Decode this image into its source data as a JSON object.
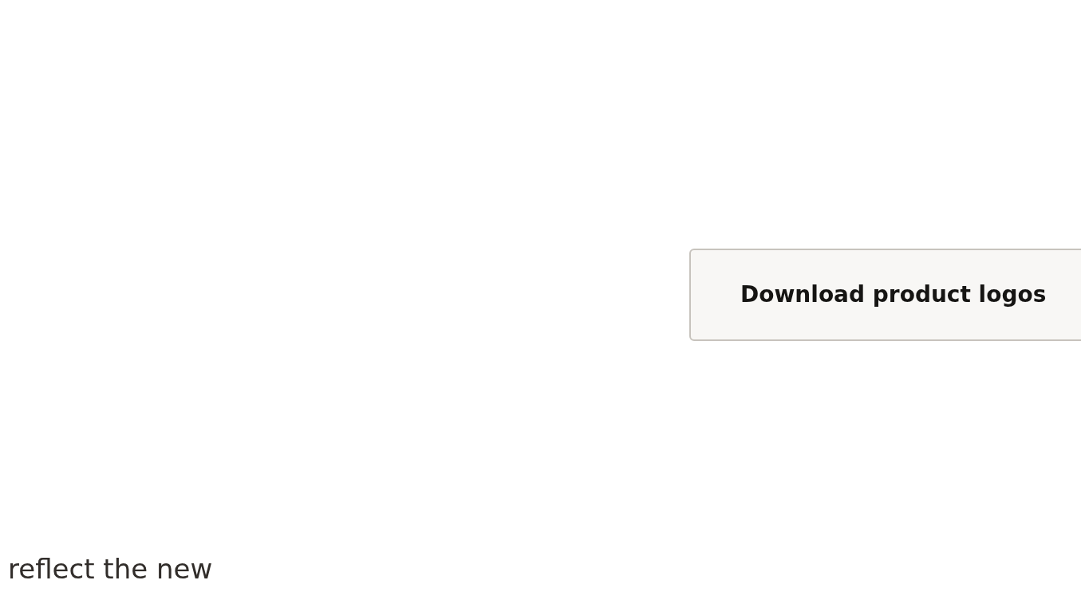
{
  "button": {
    "label": "Download product logos"
  },
  "paragraph": {
    "text": "reflect the new"
  }
}
